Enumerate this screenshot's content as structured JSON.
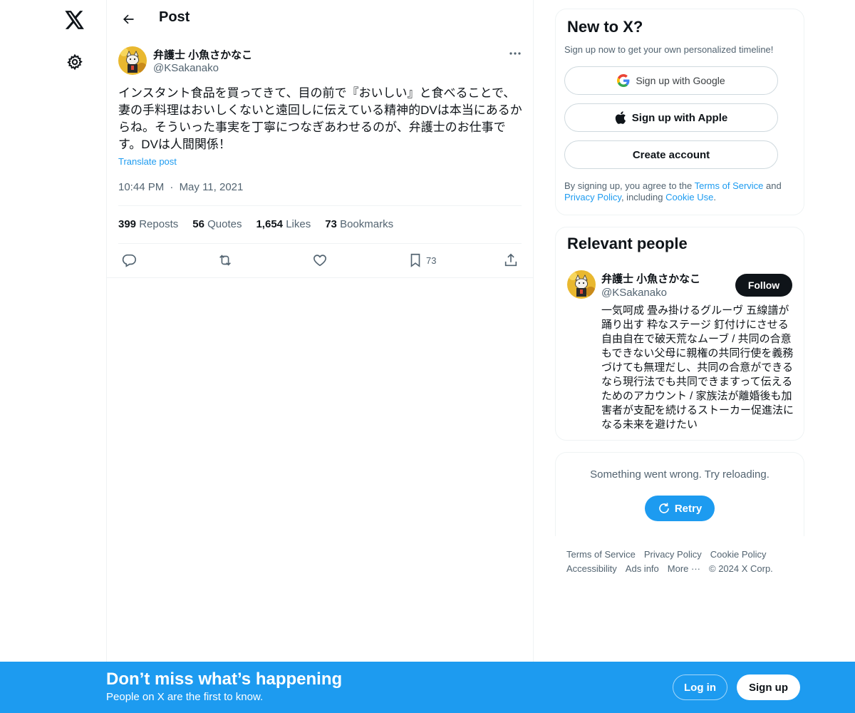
{
  "nav": {
    "logo_icon": "x-logo-icon",
    "settings_icon": "gear-icon"
  },
  "header": {
    "title": "Post",
    "back_icon": "arrow-left-icon"
  },
  "post": {
    "author_name": "弁護士 小魚さかなこ",
    "author_handle": "@KSakanako",
    "text": "インスタント食品を買ってきて、目の前で『おいしい』と食べることで、妻の手料理はおいしくないと遠回しに伝えている精神的DVは本当にあるからね。そういった事実を丁寧につなぎあわせるのが、弁護士のお仕事です。DVは人間関係！",
    "translate_label": "Translate post",
    "time": "10:44 PM",
    "separator": "·",
    "date": "May 11, 2021",
    "stats": {
      "reposts_count": "399",
      "reposts_label": "Reposts",
      "quotes_count": "56",
      "quotes_label": "Quotes",
      "likes_count": "1,654",
      "likes_label": "Likes",
      "bookmarks_count": "73",
      "bookmarks_label": "Bookmarks"
    },
    "actions": {
      "bookmark_count": "73"
    }
  },
  "signup_card": {
    "title": "New to X?",
    "subtitle": "Sign up now to get your own personalized timeline!",
    "google_label": "Sign up with Google",
    "apple_label": "Sign up with Apple",
    "create_label": "Create account",
    "terms_prefix": "By signing up, you agree to the ",
    "terms_link": "Terms of Service",
    "terms_and": " and ",
    "privacy_link": "Privacy Policy",
    "terms_including": ", including ",
    "cookie_link": "Cookie Use",
    "terms_suffix": "."
  },
  "relevant_people": {
    "title": "Relevant people",
    "name": "弁護士 小魚さかなこ",
    "handle": "@KSakanako",
    "follow_label": "Follow",
    "bio": "一気呵成 畳み掛けるグルーヴ 五線譜が踊り出す 粋なステージ 釘付けにさせる 自由自在で破天荒なムーブ / 共同の合意もできない父母に親権の共同行使を義務づけても無理だし、共同の合意ができるなら現行法でも共同できますって伝えるためのアカウント / 家族法が離婚後も加害者が支配を続けるストーカー促進法になる未来を避けたい"
  },
  "error_card": {
    "message": "Something went wrong. Try reloading.",
    "retry_label": "Retry"
  },
  "footer": {
    "terms": "Terms of Service",
    "privacy": "Privacy Policy",
    "cookie": "Cookie Policy",
    "accessibility": "Accessibility",
    "ads": "Ads info",
    "more": "More ···",
    "copyright": "© 2024 X Corp."
  },
  "banner": {
    "title": "Don’t miss what’s happening",
    "subtitle": "People on X are the first to know.",
    "login_label": "Log in",
    "signup_label": "Sign up"
  },
  "colors": {
    "accent": "#1d9bf0",
    "text": "#0f1419",
    "muted": "#536471",
    "border": "#eff3f4"
  }
}
